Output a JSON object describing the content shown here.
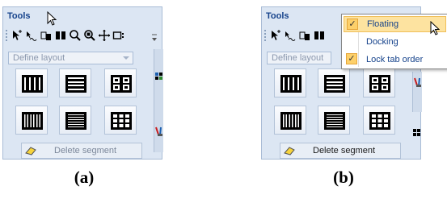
{
  "panel": {
    "title": "Tools",
    "layout_dropdown": "Define layout",
    "delete_segment": "Delete segment"
  },
  "toolbar_icons": [
    "arrow-select-icon",
    "node-tool-icon",
    "segment-tool-icon",
    "split-tool-icon",
    "zoom-icon",
    "zoom-window-icon",
    "pan-icon",
    "box-select-icon"
  ],
  "layout_buttons": [
    "two-column-layout-icon",
    "two-row-layout-icon",
    "quad-layout-icon",
    "three-column-layout-icon",
    "three-row-layout-icon",
    "nine-grid-layout-icon"
  ],
  "context_menu": {
    "items": [
      {
        "label": "Floating",
        "checked": true,
        "highlighted": true
      },
      {
        "label": "Docking",
        "checked": false,
        "highlighted": false
      },
      {
        "label": "Lock tab order",
        "checked": true,
        "highlighted": false
      }
    ],
    "check_mark": "✓"
  },
  "captions": {
    "a": "(a)",
    "b": "(b)"
  },
  "colors": {
    "title": "#15428b",
    "panel_bg": "#dce6f3",
    "menu_highlight": "#fde3a0",
    "checkbox": "#fdd06a"
  }
}
